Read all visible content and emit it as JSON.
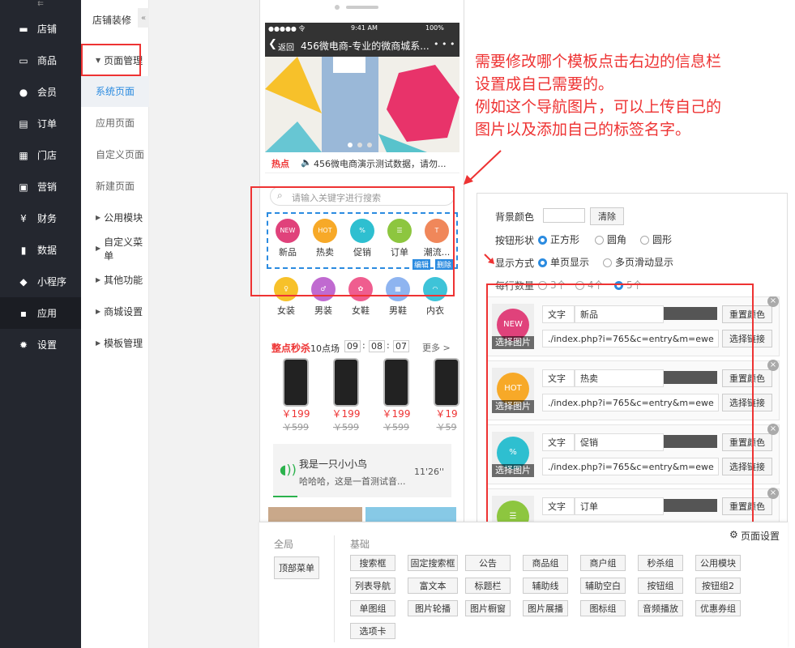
{
  "sidebar_main": {
    "items": [
      {
        "label": "店铺",
        "icon": "store-icon"
      },
      {
        "label": "商品",
        "icon": "goods-icon"
      },
      {
        "label": "会员",
        "icon": "user-icon"
      },
      {
        "label": "订单",
        "icon": "order-icon"
      },
      {
        "label": "门店",
        "icon": "shop-icon"
      },
      {
        "label": "营销",
        "icon": "gift-icon"
      },
      {
        "label": "财务",
        "icon": "finance-icon"
      },
      {
        "label": "数据",
        "icon": "chart-icon"
      },
      {
        "label": "小程序",
        "icon": "miniapp-icon"
      },
      {
        "label": "应用",
        "icon": "apps-icon"
      },
      {
        "label": "设置",
        "icon": "gear-icon"
      }
    ]
  },
  "sidebar_sub": {
    "title": "店铺装修",
    "items": [
      {
        "label": "页面管理",
        "type": "group"
      },
      {
        "label": "系统页面",
        "type": "sub"
      },
      {
        "label": "应用页面",
        "type": "sub"
      },
      {
        "label": "自定义页面",
        "type": "sub"
      },
      {
        "label": "新建页面",
        "type": "sub"
      },
      {
        "label": "公用模块",
        "type": "group"
      },
      {
        "label": "自定义菜单",
        "type": "group"
      },
      {
        "label": "其他功能",
        "type": "group"
      },
      {
        "label": "商城设置",
        "type": "group"
      },
      {
        "label": "模板管理",
        "type": "group"
      }
    ]
  },
  "phone": {
    "status_left": "●●●●● 令",
    "status_time": "9:41 AM",
    "status_right": "100%",
    "back_label": "返回",
    "title": "456微电商-专业的微商城系...",
    "more": "• • •",
    "news_tag": "热点",
    "news_text": "456微电商演示测试数据，请勿...",
    "search_placeholder": "请输入关键字进行搜索",
    "nav_row1": [
      {
        "label": "新品",
        "color": "#e0427b",
        "badge": "NEW"
      },
      {
        "label": "热卖",
        "color": "#f7a928",
        "badge": "HOT"
      },
      {
        "label": "促销",
        "color": "#2ebfd0",
        "badge": "%"
      },
      {
        "label": "订单",
        "color": "#8dc63f",
        "badge": "☰"
      },
      {
        "label": "潮流...",
        "color": "#f0875a",
        "badge": "T"
      }
    ],
    "nav_row2": [
      {
        "label": "女装",
        "color": "#f7c12a",
        "badge": "♀"
      },
      {
        "label": "男装",
        "color": "#c06ad0",
        "badge": "♂"
      },
      {
        "label": "女鞋",
        "color": "#ef5d8f",
        "badge": "✿"
      },
      {
        "label": "男鞋",
        "color": "#8eb4f0",
        "badge": "▦"
      },
      {
        "label": "内衣",
        "color": "#3ec3d8",
        "badge": "◠"
      }
    ],
    "edit_label": "编辑",
    "delete_label": "删除",
    "flash_title": "整点秒杀",
    "flash_session": "10点场",
    "flash_h": "09",
    "flash_m": "08",
    "flash_s": "07",
    "flash_more": "更多 >",
    "products": [
      {
        "price": "￥199",
        "old": "￥599"
      },
      {
        "price": "￥199",
        "old": "￥599"
      },
      {
        "price": "￥199",
        "old": "￥599"
      },
      {
        "price": "￥19",
        "old": "￥59"
      }
    ],
    "audio_title": "我是一只小小鸟",
    "audio_desc": "哈哈哈，这是一首测试音...",
    "audio_time": "11'26''"
  },
  "annotation": {
    "lines": [
      "需要修改哪个模板点击右边的信息栏",
      "设置成自己需要的。",
      "例如这个导航图片，可以上传自己的",
      "图片以及添加自己的标签名字。"
    ],
    "color": "#e33"
  },
  "settings": {
    "bg_color_label": "背景颜色",
    "clear_label": "清除",
    "shape_label": "按钮形状",
    "shape_options": [
      "正方形",
      "圆角",
      "圆形"
    ],
    "display_label": "显示方式",
    "display_options": [
      "单页显示",
      "多页滑动显示"
    ],
    "per_row_label": "每行数量",
    "per_row_options": [
      "3个",
      "4个",
      "5个"
    ],
    "nav_items": [
      {
        "text_label": "文字",
        "text_value": "新品",
        "reset": "重置颜色",
        "link": "./index.php?i=765&c=entry&m=ewe",
        "choose_link": "选择链接",
        "choose_img": "选择图片",
        "color": "#e0427b",
        "badge": "NEW"
      },
      {
        "text_label": "文字",
        "text_value": "热卖",
        "reset": "重置颜色",
        "link": "./index.php?i=765&c=entry&m=ewe",
        "choose_link": "选择链接",
        "choose_img": "选择图片",
        "color": "#f7a928",
        "badge": "HOT"
      },
      {
        "text_label": "文字",
        "text_value": "促销",
        "reset": "重置颜色",
        "link": "./index.php?i=765&c=entry&m=ewe",
        "choose_link": "选择链接",
        "choose_img": "选择图片",
        "color": "#2ebfd0",
        "badge": "%"
      },
      {
        "text_label": "文字",
        "text_value": "订单",
        "reset": "重置颜色",
        "link": "",
        "choose_link": "",
        "choose_img": "",
        "color": "#8dc63f",
        "badge": "☰"
      }
    ]
  },
  "bottom_panel": {
    "page_settings": "页面设置",
    "global_label": "全局",
    "global_btn": "顶部菜单",
    "basic_label": "基础",
    "basic_buttons": [
      "搜索框",
      "固定搜索框",
      "公告",
      "商品组",
      "商户组",
      "秒杀组",
      "公用模块",
      "列表导航",
      "富文本",
      "标题栏",
      "辅助线",
      "辅助空白",
      "按钮组",
      "按钮组2",
      "单图组",
      "图片轮播",
      "图片橱窗",
      "图片展播",
      "图标组",
      "音频播放",
      "优惠券组",
      "选项卡"
    ]
  }
}
